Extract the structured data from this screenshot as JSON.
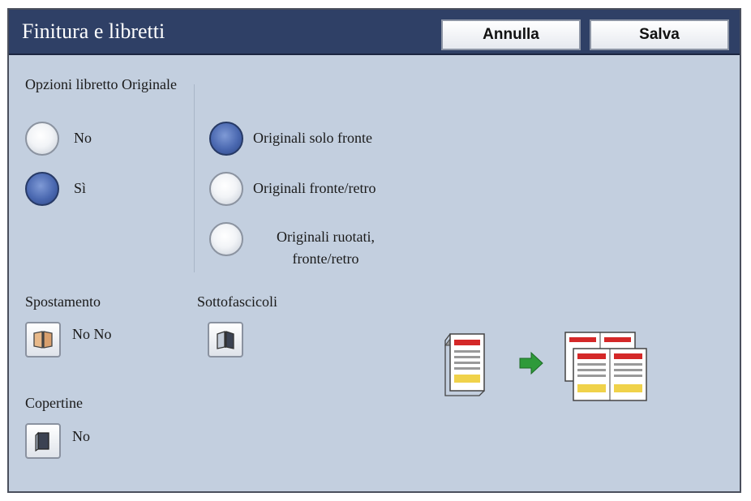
{
  "header": {
    "title": "Finitura e libretti",
    "cancel_label": "Annulla",
    "save_label": "Salva"
  },
  "original_booklet": {
    "heading": "Opzioni libretto Originale",
    "options": [
      {
        "label": "No",
        "selected": false
      },
      {
        "label": "Sì",
        "selected": true
      }
    ],
    "sides": [
      {
        "label": "Originali solo fronte",
        "selected": true
      },
      {
        "label": "Originali fronte/retro",
        "selected": false
      },
      {
        "label_line1": "Originali ruotati,",
        "label_line2": "fronte/retro",
        "selected": false
      }
    ]
  },
  "shift": {
    "heading": "Spostamento",
    "value": "No No",
    "icon": "book-open-icon"
  },
  "sub_sets": {
    "heading": "Sottofascicoli",
    "icon": "book-split-icon"
  },
  "covers": {
    "heading": "Copertine",
    "value": "No",
    "icon": "book-cover-icon"
  },
  "colors": {
    "title_bar": "#2f4066",
    "panel": "#c3cfdf",
    "radio_selected": "#4a68b0",
    "arrow": "#2e9a3a"
  }
}
